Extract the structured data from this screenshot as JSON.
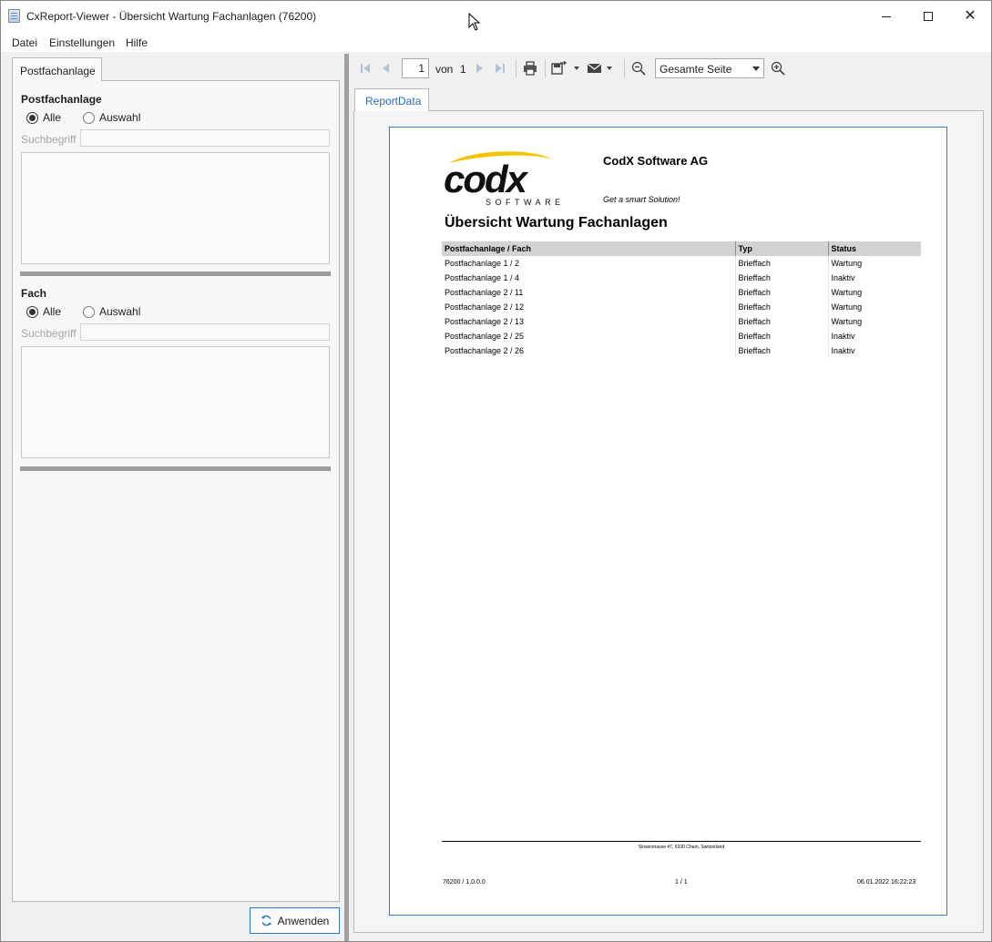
{
  "window": {
    "title": "CxReport-Viewer - Übersicht Wartung Fachanlagen (76200)"
  },
  "menu": {
    "items": [
      "Datei",
      "Einstellungen",
      "Hilfe"
    ]
  },
  "left_panel": {
    "tab_label": "Postfachanlage",
    "groups": [
      {
        "title": "Postfachanlage",
        "radio_all": "Alle",
        "radio_select": "Auswahl",
        "selected": "Alle",
        "search_label": "Suchbegriff",
        "search_value": ""
      },
      {
        "title": "Fach",
        "radio_all": "Alle",
        "radio_select": "Auswahl",
        "selected": "Alle",
        "search_label": "Suchbegriff",
        "search_value": ""
      }
    ],
    "apply_button": "Anwenden"
  },
  "toolbar": {
    "current_page": "1",
    "von_label": "von",
    "page_count": "1",
    "zoom_value": "Gesamte Seite"
  },
  "report_tab": {
    "label": "ReportData"
  },
  "report": {
    "logo_text": "codx",
    "logo_subtext": "SOFTWARE",
    "company": "CodX Software AG",
    "slogan": "Get a smart Solution!",
    "title": "Übersicht Wartung Fachanlagen",
    "columns": [
      "Postfachanlage / Fach",
      "Typ",
      "Status"
    ],
    "rows": [
      [
        "Postfachanlage 1 / 2",
        "Brieffach",
        "Wartung"
      ],
      [
        "Postfachanlage 1 / 4",
        "Brieffach",
        "Inaktiv"
      ],
      [
        "Postfachanlage 2 / 11",
        "Brieffach",
        "Wartung"
      ],
      [
        "Postfachanlage 2 / 12",
        "Brieffach",
        "Wartung"
      ],
      [
        "Postfachanlage 2 / 13",
        "Brieffach",
        "Wartung"
      ],
      [
        "Postfachanlage 2 / 25",
        "Brieffach",
        "Inaktiv"
      ],
      [
        "Postfachanlage 2 / 26",
        "Brieffach",
        "Inaktiv"
      ]
    ],
    "footer_address": "Sinserstrasse 47, 6330 Cham, Switzerland",
    "footer_left": "76200 / 1.0.0.0",
    "footer_page": "1 / 1",
    "footer_date": "06.01.2022 16:22:23"
  },
  "colors": {
    "accent": "#2b79c2",
    "logo_yellow": "#f2c500",
    "page_border": "#2f7fbf"
  }
}
